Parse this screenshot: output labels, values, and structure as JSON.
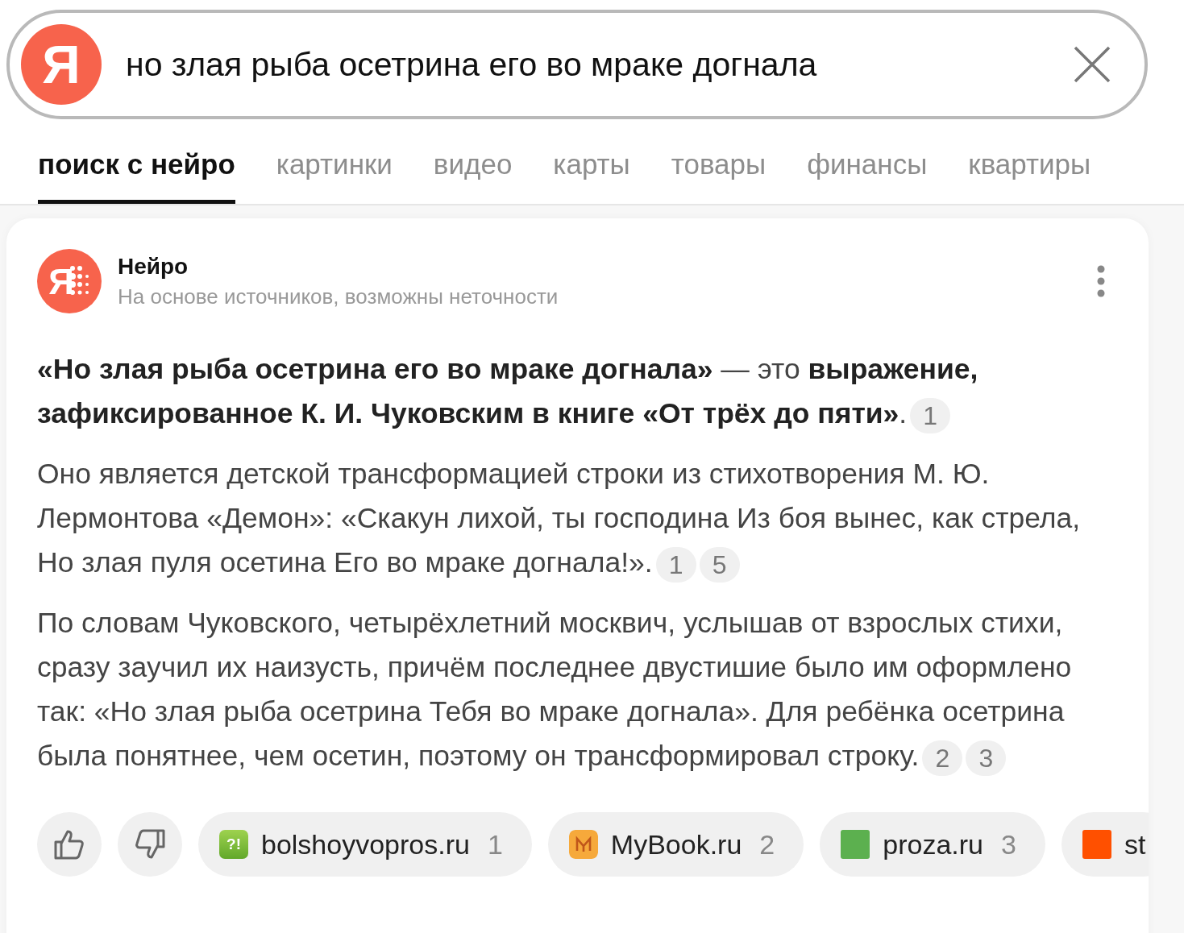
{
  "search": {
    "logo": "Я",
    "query": "но злая рыба осетрина его во мраке догнала"
  },
  "tabs": [
    {
      "label": "поиск с нейро",
      "selected": true
    },
    {
      "label": "картинки",
      "selected": false
    },
    {
      "label": "видео",
      "selected": false
    },
    {
      "label": "карты",
      "selected": false
    },
    {
      "label": "товары",
      "selected": false
    },
    {
      "label": "финансы",
      "selected": false
    },
    {
      "label": "квартиры",
      "selected": false
    }
  ],
  "answer": {
    "icon_letter": "Я",
    "title": "Нейро",
    "subtitle": "На основе источников, возможны неточности",
    "paragraphs": [
      {
        "text": "**«Но злая рыба осетрина его во мраке догнала»** — это **выражение, зафиксированное К. И. Чуковским в книге «От трёх до пяти»**.",
        "citations": [
          "1"
        ]
      },
      {
        "text": "Оно является детской трансформацией строки из стихотворения М. Ю. Лермонтова «Демон»: «Скакун лихой, ты господина Из боя вынес, как стрела, Но злая пуля осетина Его во мраке догнала!».",
        "citations": [
          "1",
          "5"
        ]
      },
      {
        "text": "По словам Чуковского, четырёхлетний москвич, услышав от взрослых стихи, сразу заучил их наизусть, причём последнее двустишие было им оформлено так: «Но злая рыба осетрина Тебя во мраке догнала». Для ребёнка осетрина была понятнее, чем осетин, поэтому он трансформировал строку.",
        "citations": [
          "2",
          "3"
        ]
      }
    ]
  },
  "sources": [
    {
      "kind": "badge",
      "icon": "?!",
      "name": "bolshoyvopros.ru",
      "index": "1"
    },
    {
      "kind": "book",
      "name": "MyBook.ru",
      "index": "2"
    },
    {
      "kind": "square",
      "color": "#5cb04f",
      "name": "proza.ru",
      "index": "3"
    },
    {
      "kind": "square",
      "color": "#ff5000",
      "name": "st"
    }
  ]
}
